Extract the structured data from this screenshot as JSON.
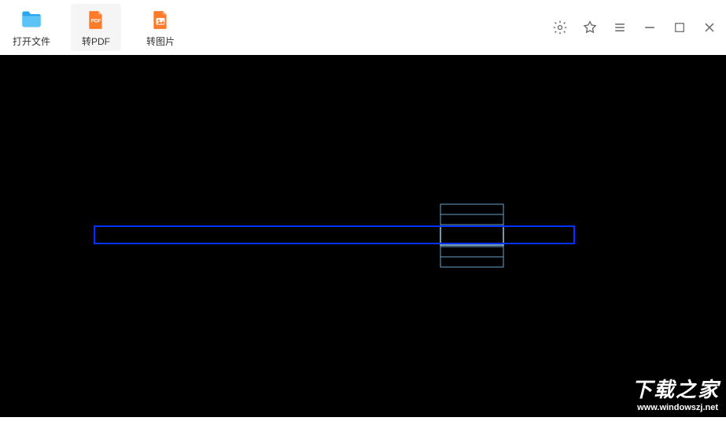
{
  "toolbar": {
    "open_file": "打开文件",
    "to_pdf": "转PDF",
    "to_image": "转图片"
  },
  "tooltip": {
    "to_pdf": "转PDF"
  },
  "icons": {
    "folder": "folder-icon",
    "pdf": "pdf-icon",
    "image": "image-icon",
    "gear": "gear-icon",
    "star": "star-icon",
    "menu": "menu-icon",
    "minimize": "minimize-icon",
    "maximize": "maximize-icon",
    "close": "close-icon"
  },
  "colors": {
    "folder": "#2AA7F0",
    "pdf": "#FF7A29",
    "image": "#FF7A29",
    "cad_blue": "#0033FF",
    "cad_light": "#6CA6CD"
  },
  "watermark": {
    "line1": "下载之家",
    "line2": "www.windowszj.net"
  }
}
